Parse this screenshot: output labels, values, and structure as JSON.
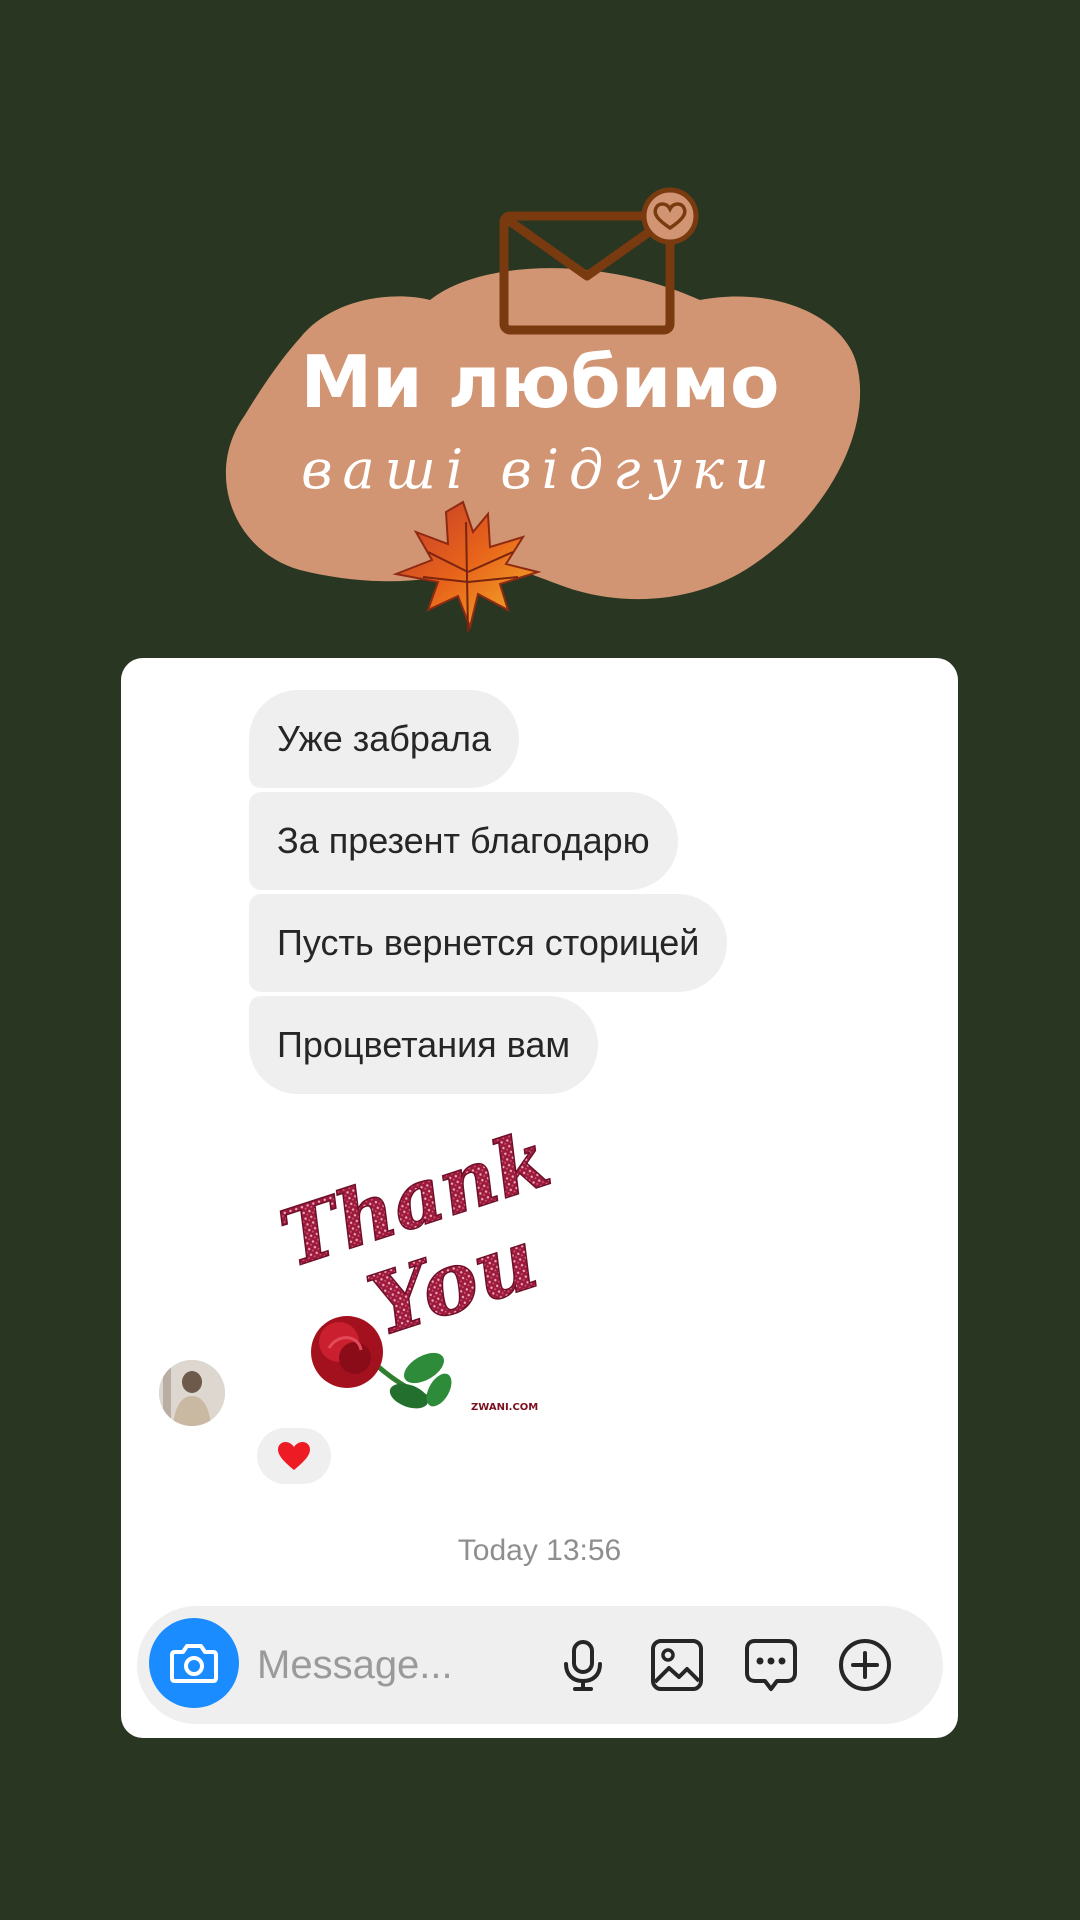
{
  "header": {
    "title": "Ми любимо",
    "subtitle": "ваші  відгуки",
    "icons": [
      "envelope-heart-icon",
      "autumn-leaf-icon"
    ],
    "colors": {
      "background": "#283622",
      "blob": "#d29573",
      "envelope": "#7a3a10"
    }
  },
  "chat": {
    "messages": [
      {
        "text": "Уже забрала"
      },
      {
        "text": "За презент благодарю"
      },
      {
        "text": "Пусть вернется сторицей"
      },
      {
        "text": "Процветания вам"
      }
    ],
    "gif": {
      "line1": "Thank",
      "line2": "You",
      "watermark": "ZWANI.COM"
    },
    "reaction": "heart",
    "timestamp": "Today 13:56",
    "composer": {
      "placeholder": "Message...",
      "icons": [
        "camera-icon",
        "microphone-icon",
        "gallery-icon",
        "sticker-icon",
        "plus-icon"
      ]
    },
    "colors": {
      "bubble": "#efefef",
      "camera_button": "#1a8cff",
      "heart": "#ed1c24"
    }
  }
}
